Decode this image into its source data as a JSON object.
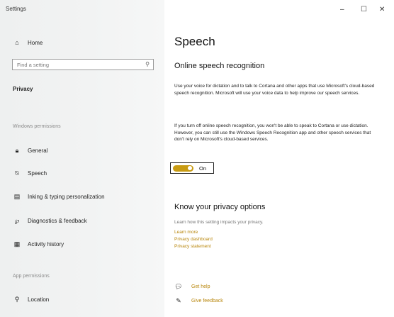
{
  "window": {
    "title": "Settings",
    "controls": {
      "minimize": "–",
      "maximize": "☐",
      "close": "✕"
    }
  },
  "sidebar": {
    "home": {
      "label": "Home",
      "icon": "home-icon"
    },
    "search": {
      "placeholder": "Find a setting"
    },
    "category_title": "Privacy",
    "section_windows": "Windows permissions",
    "items": [
      {
        "label": "General",
        "icon": "lock-icon"
      },
      {
        "label": "Speech",
        "icon": "speech-icon"
      },
      {
        "label": "Inking & typing personalization",
        "icon": "inking-icon"
      },
      {
        "label": "Diagnostics & feedback",
        "icon": "diagnostics-icon"
      },
      {
        "label": "Activity history",
        "icon": "activity-icon"
      }
    ],
    "section_app": "App permissions",
    "app_items": [
      {
        "label": "Location",
        "icon": "location-icon"
      }
    ]
  },
  "main": {
    "page_title": "Speech",
    "section_title": "Online speech recognition",
    "para1": "Use your voice for dictation and to talk to Cortana and other apps that use Microsoft's cloud-based speech recognition. Microsoft will use your voice data to help improve our speech services.",
    "para2": "If you turn off online speech recognition, you won't be able to speak to Cortana or use dictation. However, you can still use the Windows Speech Recognition app and other speech services that don't rely on Microsoft's cloud-based services.",
    "toggle": {
      "label": "On",
      "state": true,
      "color": "#c89b12"
    },
    "privacy_title": "Know your privacy options",
    "privacy_desc": "Learn how this setting impacts your privacy.",
    "links": [
      "Learn more",
      "Privacy dashboard",
      "Privacy statement"
    ],
    "help": [
      {
        "label": "Get help",
        "icon": "help-chat-icon"
      },
      {
        "label": "Give feedback",
        "icon": "feedback-icon"
      }
    ]
  }
}
